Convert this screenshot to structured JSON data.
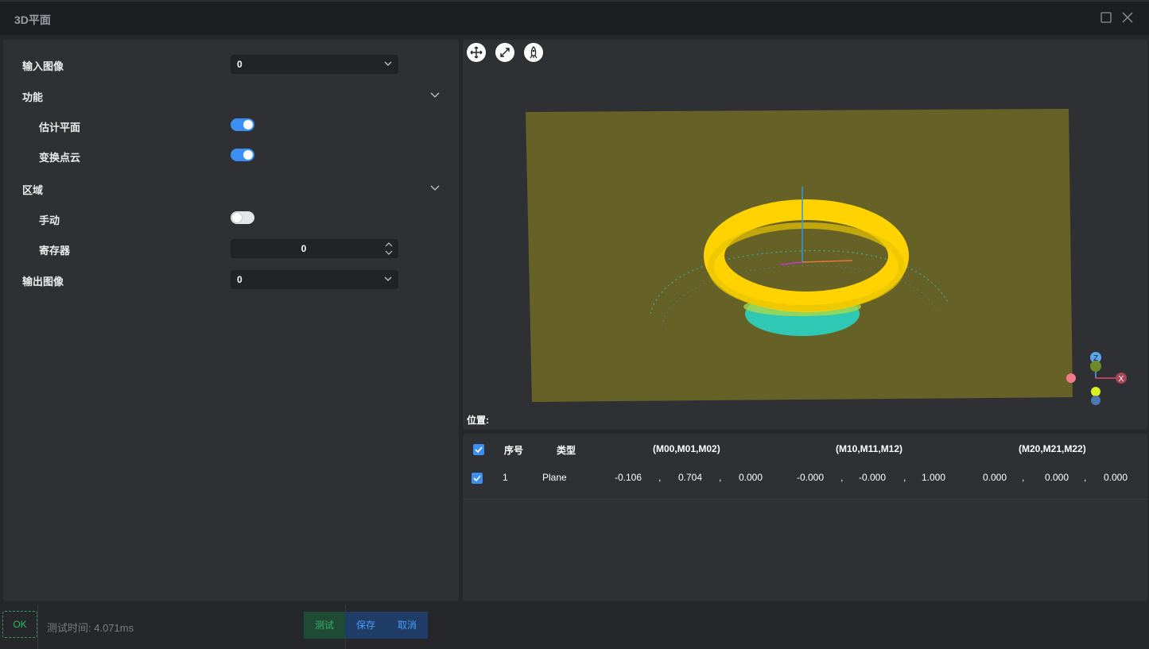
{
  "window": {
    "title": "3D平面"
  },
  "params": {
    "input_image": {
      "label": "输入图像",
      "value": "0"
    },
    "function": {
      "label": "功能"
    },
    "estimate_plane": {
      "label": "估计平面",
      "on": true
    },
    "transform_cloud": {
      "label": "变换点云",
      "on": true
    },
    "region": {
      "label": "区域"
    },
    "manual": {
      "label": "手动",
      "on": false
    },
    "register": {
      "label": "寄存器",
      "value": "0"
    },
    "output_image": {
      "label": "输出图像",
      "value": "0"
    }
  },
  "viewer": {
    "tools": [
      "move-icon",
      "fit-icon",
      "rocket-icon"
    ],
    "position_label": "位置:",
    "axes": {
      "z": "Z",
      "x": "X"
    },
    "plane_color": "#656127",
    "ring_color": "#ffd200",
    "bowl_color": "#2ec8b4"
  },
  "table": {
    "headers": {
      "index": "序号",
      "type": "类型",
      "row0": "(M00,M01,M02)",
      "row1": "(M10,M11,M12)",
      "row2": "(M20,M21,M22)"
    },
    "rows": [
      {
        "index": "1",
        "type": "Plane",
        "m": [
          "-0.106",
          "0.704",
          "0.000",
          "-0.000",
          "-0.000",
          "1.000",
          "0.000",
          "0.000",
          "0.000"
        ],
        "sep": ","
      }
    ]
  },
  "footer": {
    "status": "OK",
    "timing": "测试时间: 4.071ms",
    "test_label": "测试",
    "save_label": "保存",
    "cancel_label": "取消"
  }
}
